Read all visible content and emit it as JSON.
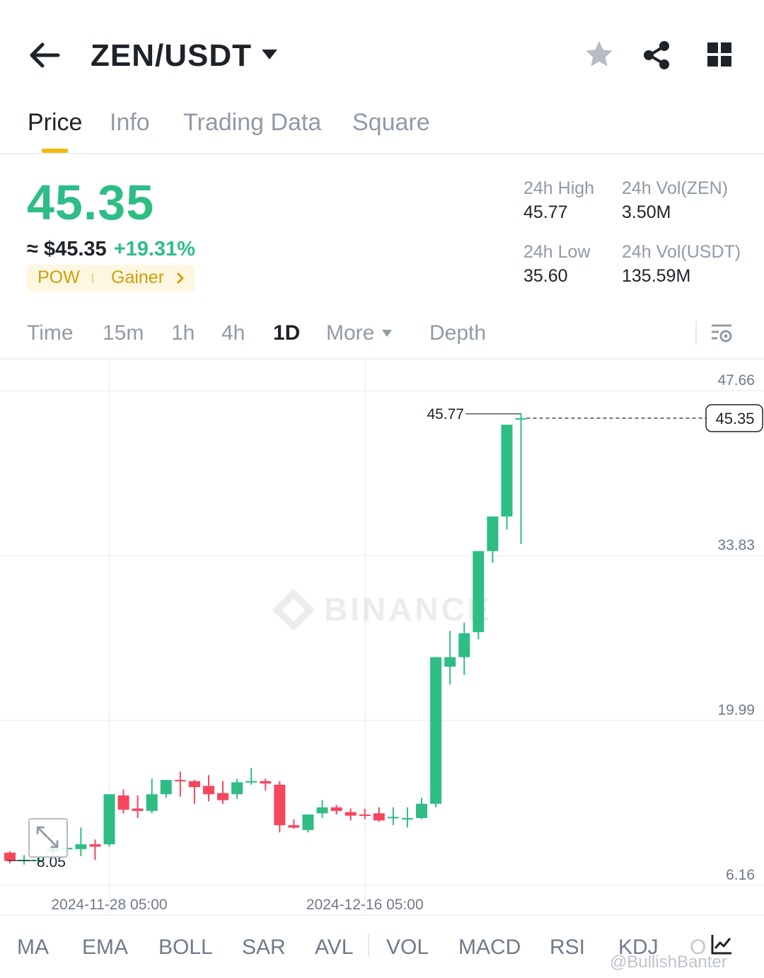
{
  "header": {
    "pair": "ZEN/USDT",
    "icons": [
      "arrow-left-icon",
      "caret-down-icon",
      "star-icon",
      "share-icon",
      "grid-icon"
    ]
  },
  "tabs": [
    {
      "label": "Price",
      "active": true
    },
    {
      "label": "Info",
      "active": false
    },
    {
      "label": "Trading Data",
      "active": false
    },
    {
      "label": "Square",
      "active": false
    }
  ],
  "ticker": {
    "last_price": "45.35",
    "fiat_price": "≈ $45.35",
    "change": "+19.31%",
    "tag_category": "POW",
    "tag_gainer": "Gainer",
    "high_label": "24h High",
    "high_value": "45.77",
    "low_label": "24h Low",
    "low_value": "35.60",
    "vol_base_label": "24h Vol(ZEN)",
    "vol_base_value": "3.50M",
    "vol_quote_label": "24h Vol(USDT)",
    "vol_quote_value": "135.59M",
    "colors": {
      "up": "#2ebd85",
      "down": "#f6465d",
      "accent": "#f0b90b"
    }
  },
  "intervals": [
    {
      "label": "Time",
      "active": false
    },
    {
      "label": "15m",
      "active": false
    },
    {
      "label": "1h",
      "active": false
    },
    {
      "label": "4h",
      "active": false
    },
    {
      "label": "1D",
      "active": true
    },
    {
      "label": "More",
      "active": false
    },
    {
      "label": "Depth",
      "active": false
    }
  ],
  "chart_data": {
    "type": "candlestick",
    "y_ticks": [
      47.66,
      33.83,
      19.99,
      6.16
    ],
    "y_tick_labels": [
      "47.66",
      "33.83",
      "19.99",
      "6.16"
    ],
    "ylim": [
      6.16,
      47.66
    ],
    "x_tick_labels": [
      "2024-11-28 05:00",
      "2024-12-16 05:00"
    ],
    "x_tick_index": [
      7,
      25
    ],
    "high_marker": "45.77",
    "low_marker": "8.05",
    "current_price_label": "45.35",
    "current_price": 45.35,
    "watermark": "BINANCE",
    "candles": [
      {
        "o": 8.9,
        "h": 9.0,
        "l": 8.0,
        "c": 8.2
      },
      {
        "o": 8.2,
        "h": 8.7,
        "l": 7.9,
        "c": 8.3
      },
      {
        "o": 8.2,
        "h": 8.5,
        "l": 8.0,
        "c": 8.3
      },
      {
        "o": 9.0,
        "h": 9.8,
        "l": 8.5,
        "c": 9.2
      },
      {
        "o": 9.2,
        "h": 11.5,
        "l": 8.7,
        "c": 9.3
      },
      {
        "o": 9.2,
        "h": 11.0,
        "l": 8.6,
        "c": 9.6
      },
      {
        "o": 9.6,
        "h": 10.0,
        "l": 8.3,
        "c": 9.4
      },
      {
        "o": 9.6,
        "h": 13.8,
        "l": 9.4,
        "c": 13.8
      },
      {
        "o": 13.7,
        "h": 14.2,
        "l": 12.2,
        "c": 12.5
      },
      {
        "o": 12.6,
        "h": 13.7,
        "l": 11.8,
        "c": 12.4
      },
      {
        "o": 12.4,
        "h": 15.1,
        "l": 12.2,
        "c": 13.8
      },
      {
        "o": 13.8,
        "h": 15.0,
        "l": 13.5,
        "c": 15.0
      },
      {
        "o": 15.0,
        "h": 15.7,
        "l": 13.6,
        "c": 14.9
      },
      {
        "o": 14.9,
        "h": 15.0,
        "l": 13.0,
        "c": 14.4
      },
      {
        "o": 14.5,
        "h": 15.4,
        "l": 13.2,
        "c": 13.8
      },
      {
        "o": 13.9,
        "h": 14.9,
        "l": 13.0,
        "c": 13.3
      },
      {
        "o": 13.8,
        "h": 15.1,
        "l": 13.4,
        "c": 14.8
      },
      {
        "o": 14.8,
        "h": 16.0,
        "l": 14.6,
        "c": 14.9
      },
      {
        "o": 14.9,
        "h": 15.1,
        "l": 14.1,
        "c": 14.7
      },
      {
        "o": 14.6,
        "h": 14.9,
        "l": 10.6,
        "c": 11.2
      },
      {
        "o": 11.2,
        "h": 11.7,
        "l": 10.9,
        "c": 11.0
      },
      {
        "o": 10.8,
        "h": 12.1,
        "l": 10.6,
        "c": 12.1
      },
      {
        "o": 12.2,
        "h": 13.3,
        "l": 11.8,
        "c": 12.7
      },
      {
        "o": 12.7,
        "h": 12.9,
        "l": 12.1,
        "c": 12.4
      },
      {
        "o": 12.3,
        "h": 12.6,
        "l": 11.6,
        "c": 12.0
      },
      {
        "o": 12.1,
        "h": 12.6,
        "l": 11.7,
        "c": 12.0
      },
      {
        "o": 12.2,
        "h": 12.7,
        "l": 11.5,
        "c": 11.6
      },
      {
        "o": 11.8,
        "h": 12.7,
        "l": 11.2,
        "c": 11.9
      },
      {
        "o": 11.8,
        "h": 12.7,
        "l": 11.0,
        "c": 11.8
      },
      {
        "o": 11.8,
        "h": 13.5,
        "l": 11.7,
        "c": 13.0
      },
      {
        "o": 13.0,
        "h": 25.2,
        "l": 12.7,
        "c": 25.3
      },
      {
        "o": 24.5,
        "h": 27.5,
        "l": 23.0,
        "c": 25.3
      },
      {
        "o": 25.3,
        "h": 28.2,
        "l": 23.8,
        "c": 27.3
      },
      {
        "o": 27.4,
        "h": 33.8,
        "l": 26.8,
        "c": 34.2
      },
      {
        "o": 34.2,
        "h": 35.2,
        "l": 33.2,
        "c": 37.1
      },
      {
        "o": 37.1,
        "h": 38.4,
        "l": 36.0,
        "c": 44.8
      },
      {
        "o": 45.35,
        "h": 45.77,
        "l": 34.8,
        "c": 45.35
      }
    ]
  },
  "indicators": [
    "MA",
    "EMA",
    "BOLL",
    "SAR",
    "AVL",
    "VOL",
    "MACD",
    "RSI",
    "KDJ",
    "O"
  ],
  "credit": "@BullishBanter"
}
